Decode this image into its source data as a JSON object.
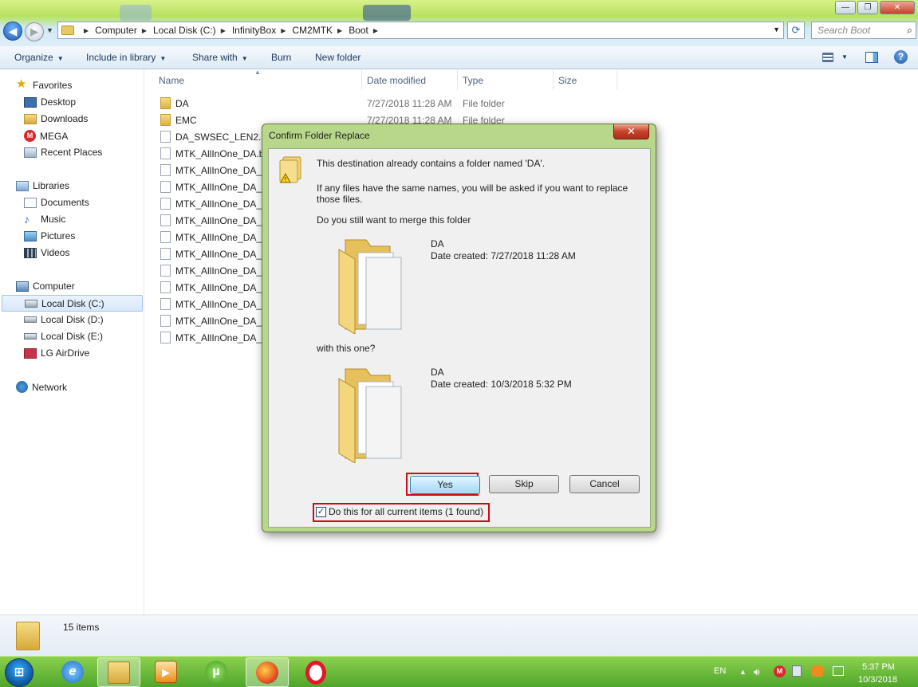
{
  "window": {
    "minimize_glyph": "—",
    "maximize_glyph": "❐",
    "close_glyph": "✕"
  },
  "address": {
    "crumbs": [
      "Computer",
      "Local Disk (C:)",
      "InfinityBox",
      "CM2MTK",
      "Boot"
    ],
    "search_placeholder": "Search Boot"
  },
  "toolbar": {
    "organize": "Organize",
    "include_in_library": "Include in library",
    "share_with": "Share with",
    "burn": "Burn",
    "new_folder": "New folder"
  },
  "nav": {
    "favorites": "Favorites",
    "desktop": "Desktop",
    "downloads": "Downloads",
    "mega": "MEGA",
    "recent_places": "Recent Places",
    "libraries": "Libraries",
    "documents": "Documents",
    "music": "Music",
    "pictures": "Pictures",
    "videos": "Videos",
    "computer": "Computer",
    "local_c": "Local Disk (C:)",
    "local_d": "Local Disk (D:)",
    "local_e": "Local Disk (E:)",
    "lg_airdrive": "LG AirDrive",
    "network": "Network"
  },
  "columns": {
    "name": "Name",
    "date_modified": "Date modified",
    "type": "Type",
    "size": "Size"
  },
  "files": [
    {
      "name": "DA",
      "date": "7/27/2018 11:28 AM",
      "type": "File folder",
      "kind": "folder"
    },
    {
      "name": "EMC",
      "date": "7/27/2018 11:28 AM",
      "type": "File folder",
      "kind": "folder"
    },
    {
      "name": "DA_SWSEC_LEN2.bin",
      "date": "",
      "type": "",
      "kind": "file"
    },
    {
      "name": "MTK_AllInOne_DA.bin",
      "date": "",
      "type": "",
      "kind": "file"
    },
    {
      "name": "MTK_AllInOne_DA_P",
      "date": "",
      "type": "",
      "kind": "file"
    },
    {
      "name": "MTK_AllInOne_DA_S",
      "date": "",
      "type": "",
      "kind": "file"
    },
    {
      "name": "MTK_AllInOne_DA_S",
      "date": "",
      "type": "",
      "kind": "file"
    },
    {
      "name": "MTK_AllInOne_DA_S",
      "date": "",
      "type": "",
      "kind": "file"
    },
    {
      "name": "MTK_AllInOne_DA_S",
      "date": "",
      "type": "",
      "kind": "file"
    },
    {
      "name": "MTK_AllInOne_DA_S",
      "date": "",
      "type": "",
      "kind": "file"
    },
    {
      "name": "MTK_AllInOne_DA_S",
      "date": "",
      "type": "",
      "kind": "file"
    },
    {
      "name": "MTK_AllInOne_DA_S",
      "date": "",
      "type": "",
      "kind": "file"
    },
    {
      "name": "MTK_AllInOne_DA_S",
      "date": "",
      "type": "",
      "kind": "file"
    },
    {
      "name": "MTK_AllInOne_DA_S",
      "date": "",
      "type": "",
      "kind": "file"
    },
    {
      "name": "MTK_AllInOne_DA_S",
      "date": "",
      "type": "",
      "kind": "file"
    }
  ],
  "status": {
    "items": "15 items"
  },
  "dialog": {
    "title": "Confirm Folder Replace",
    "close_glyph": "✕",
    "line1": "This destination already contains a folder named 'DA'.",
    "line2a": "If any files have the same names, you will be asked if you want to replace",
    "line2b": "those files.",
    "line3": "Do you still want to merge this folder",
    "existing_name": "DA",
    "existing_date": "Date created: 7/27/2018 11:28 AM",
    "with_this_one": "with this one?",
    "new_name": "DA",
    "new_date": "Date created: 10/3/2018 5:32 PM",
    "yes": "Yes",
    "skip": "Skip",
    "cancel": "Cancel",
    "checkbox_label": "Do this for all current items (1 found)",
    "checkbox_checked": true
  },
  "taskbar": {
    "language": "EN",
    "time": "5:37 PM",
    "date": "10/3/2018"
  },
  "colors": {
    "highlight_red": "#d10a12",
    "dialog_frame": "#b9d78b",
    "taskbar_green": "#5fb535"
  }
}
